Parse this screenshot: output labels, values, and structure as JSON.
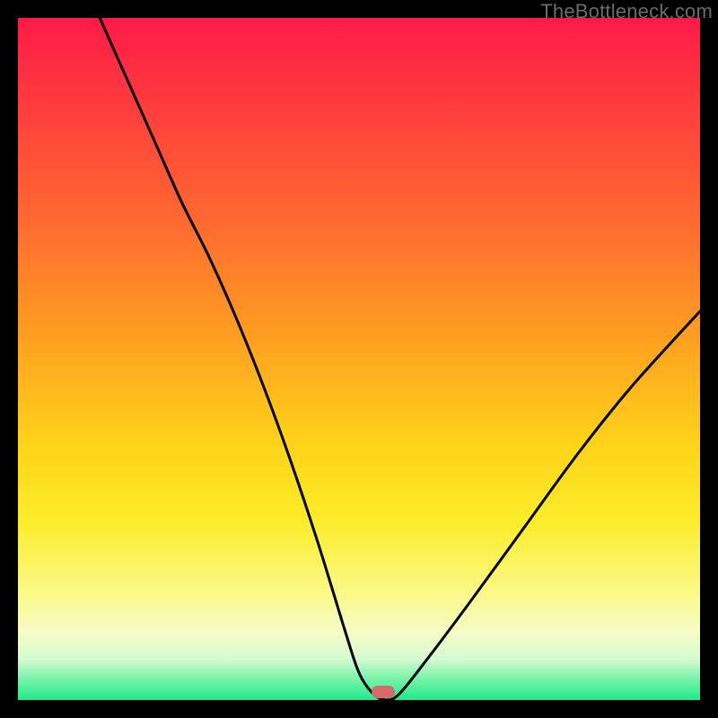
{
  "watermark": "TheBottleneck.com",
  "marker": {
    "x_frac": 0.535,
    "y_frac": 0.988
  },
  "chart_data": {
    "type": "line",
    "title": "",
    "xlabel": "",
    "ylabel": "",
    "xlim": [
      0,
      100
    ],
    "ylim": [
      0,
      100
    ],
    "series": [
      {
        "name": "bottleneck-curve",
        "x": [
          12,
          16,
          20,
          24,
          28,
          32,
          36,
          40,
          44,
          48,
          50,
          52,
          54,
          56,
          60,
          66,
          74,
          82,
          90,
          100
        ],
        "y": [
          100,
          91,
          82,
          73,
          65,
          56,
          46,
          35,
          23,
          10,
          4,
          1,
          0,
          1,
          6,
          14,
          25,
          36,
          46,
          57
        ]
      }
    ],
    "annotations": [
      {
        "name": "optimal-marker",
        "x": 53.5,
        "y": 1.2
      }
    ]
  }
}
